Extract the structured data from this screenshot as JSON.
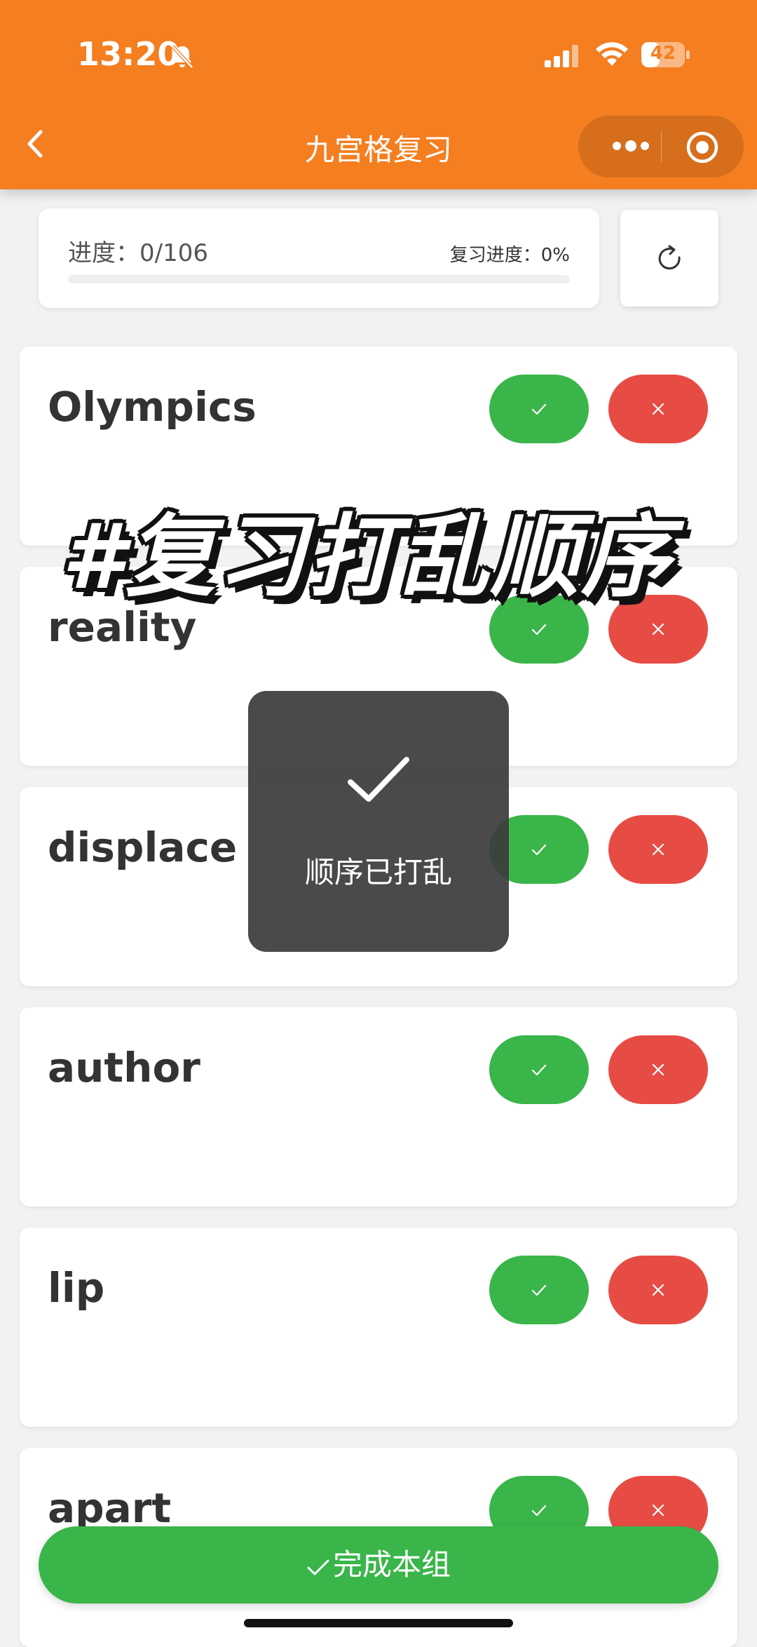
{
  "status_bar": {
    "time": "13:20",
    "battery": "42",
    "battery_level_percent": 42
  },
  "header": {
    "title": "九宫格复习"
  },
  "progress": {
    "label": "进度：0/106",
    "review_label": "复习进度：0%",
    "fraction": 0
  },
  "words": [
    {
      "word": "Olympics"
    },
    {
      "word": "reality"
    },
    {
      "word": "displace"
    },
    {
      "word": "author"
    },
    {
      "word": "lip"
    },
    {
      "word": "apart"
    }
  ],
  "overlay_title": "#复习打乱顺序",
  "toast": {
    "text": "顺序已打乱"
  },
  "footer": {
    "finish_label": "完成本组"
  },
  "colors": {
    "header": "#f47e20",
    "accent_green": "#3ab54a",
    "danger_red": "#e64c44",
    "background": "#f2f2f2"
  },
  "icons": {
    "back": "chevron-left-icon",
    "more": "more-dots-icon",
    "close_app": "target-circle-icon",
    "refresh": "refresh-icon",
    "know": "check-icon",
    "unknown": "close-icon"
  }
}
